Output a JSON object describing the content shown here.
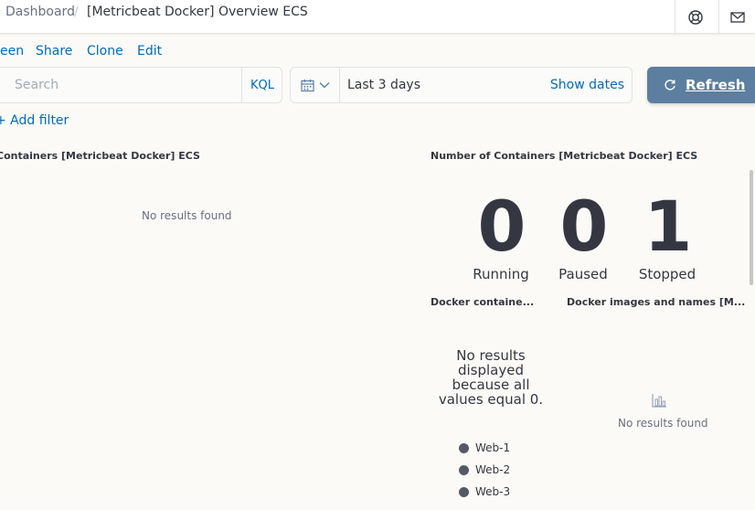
{
  "breadcrumb": {
    "root": "Dashboard",
    "separator": "/",
    "current": "[Metricbeat Docker] Overview ECS"
  },
  "top_icons": [
    "help-icon",
    "mail-icon"
  ],
  "menu": {
    "full_screen": "een",
    "share": "Share",
    "clone": "Clone",
    "edit": "Edit"
  },
  "search": {
    "placeholder": "Search",
    "language": "KQL"
  },
  "time": {
    "range": "Last 3 days",
    "show_dates": "Show dates",
    "refresh": "Refresh"
  },
  "filter": {
    "add_label": "+ Add filter"
  },
  "panels": {
    "left": {
      "title": "Containers [Metricbeat Docker] ECS",
      "empty": "No results found"
    },
    "count": {
      "title": "Number of Containers [Metricbeat Docker] ECS",
      "metrics": [
        {
          "value": "0",
          "label": "Running"
        },
        {
          "value": "0",
          "label": "Paused"
        },
        {
          "value": "1",
          "label": "Stopped"
        }
      ]
    },
    "containers": {
      "title": "Docker containe...",
      "message": "No results displayed because all values equal 0.",
      "legend": [
        "Web-1",
        "Web-2",
        "Web-3"
      ]
    },
    "images": {
      "title": "Docker images and names [M...",
      "empty": "No results found",
      "icon": "visualize-icon"
    }
  },
  "colors": {
    "accent": "#006bb8",
    "refresh_bg": "#5c7f9f",
    "legend_dot": "#545a64"
  }
}
